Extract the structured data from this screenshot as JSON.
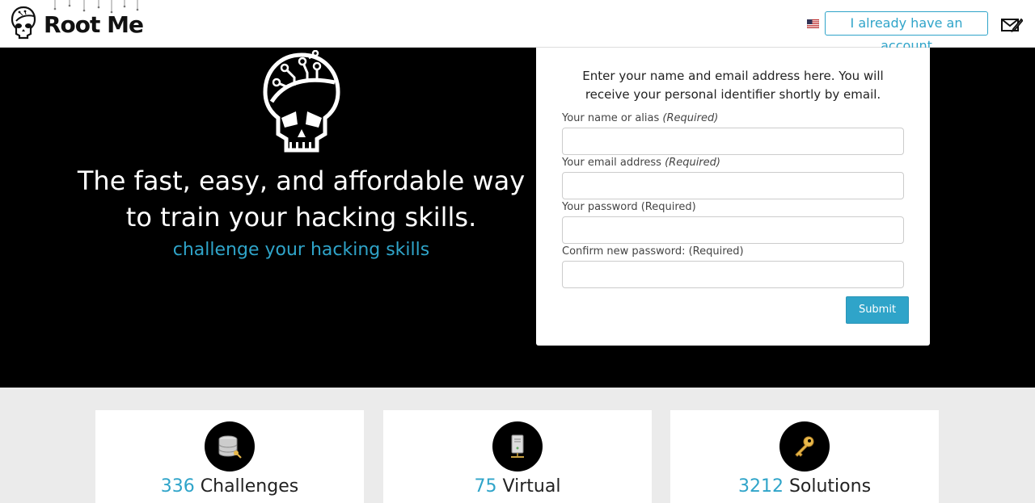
{
  "header": {
    "logo_text": "Root Me",
    "language_flag_icon": "us-flag-icon",
    "account_button_label": "I already have an account",
    "mail_icon": "envelope-pen-icon"
  },
  "hero": {
    "title_line1": "The fast, easy, and affordable way",
    "title_line2": "to train your hacking skills.",
    "subtitle": "challenge your hacking skills"
  },
  "register": {
    "intro": "Enter your name and email address here. You will receive your personal identifier shortly by email.",
    "fields": [
      {
        "label": "Your name or alias",
        "required": "(Required)",
        "value": ""
      },
      {
        "label": "Your email address",
        "required": "(Required)",
        "value": ""
      },
      {
        "label": "Your password (Required)",
        "value": ""
      },
      {
        "label": "Confirm new password: (Required)",
        "value": ""
      }
    ],
    "submit_label": "Submit"
  },
  "stats": [
    {
      "number": "336",
      "label": "Challenges",
      "icon": "database-key-icon"
    },
    {
      "number": "75",
      "label": "Virtual",
      "icon": "server-tower-icon"
    },
    {
      "number": "3212",
      "label": "Solutions",
      "icon": "key-icon"
    }
  ],
  "colors": {
    "accent": "#2fa4c9",
    "hero_background": "#000000",
    "page_background": "#ebebeb"
  }
}
